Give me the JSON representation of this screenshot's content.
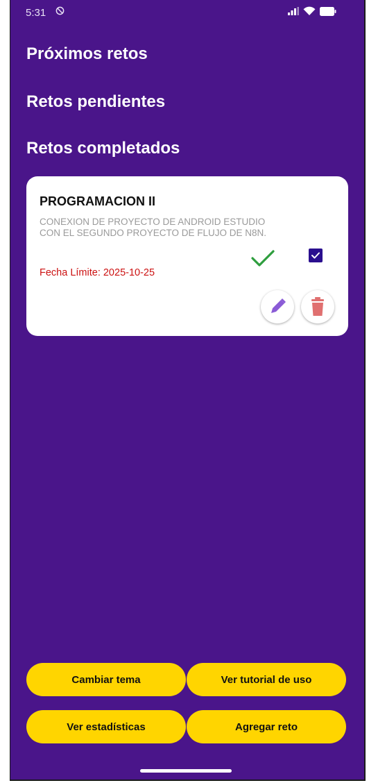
{
  "status_bar": {
    "time": "5:31",
    "dnd_icon": "do-not-disturb-icon",
    "signal_icon": "signal-icon",
    "wifi_icon": "wifi-icon",
    "battery_icon": "battery-icon"
  },
  "sections": {
    "upcoming": "Próximos retos",
    "pending": "Retos pendientes",
    "completed": "Retos completados"
  },
  "completed_card": {
    "title": "PROGRAMACION II",
    "description": "CONEXION DE PROYECTO DE ANDROID ESTUDIO CON EL SEGUNDO PROYECTO DE FLUJO DE N8N.",
    "due_date": "Fecha Límite: 2025-10-25",
    "completed": true,
    "checkbox_checked": true,
    "edit_icon": "pencil-icon",
    "delete_icon": "trash-icon"
  },
  "buttons": {
    "change_theme": "Cambiar tema",
    "tutorial": "Ver tutorial de uso",
    "statistics": "Ver estadísticas",
    "add_challenge": "Agregar reto"
  },
  "colors": {
    "background": "#4a158a",
    "card": "#ffffff",
    "button": "#ffd500",
    "due_date": "#cc1111",
    "check": "#2e9e3e",
    "checkbox": "#2a0f8f",
    "edit": "#8a5bd6",
    "delete": "#e07070"
  }
}
